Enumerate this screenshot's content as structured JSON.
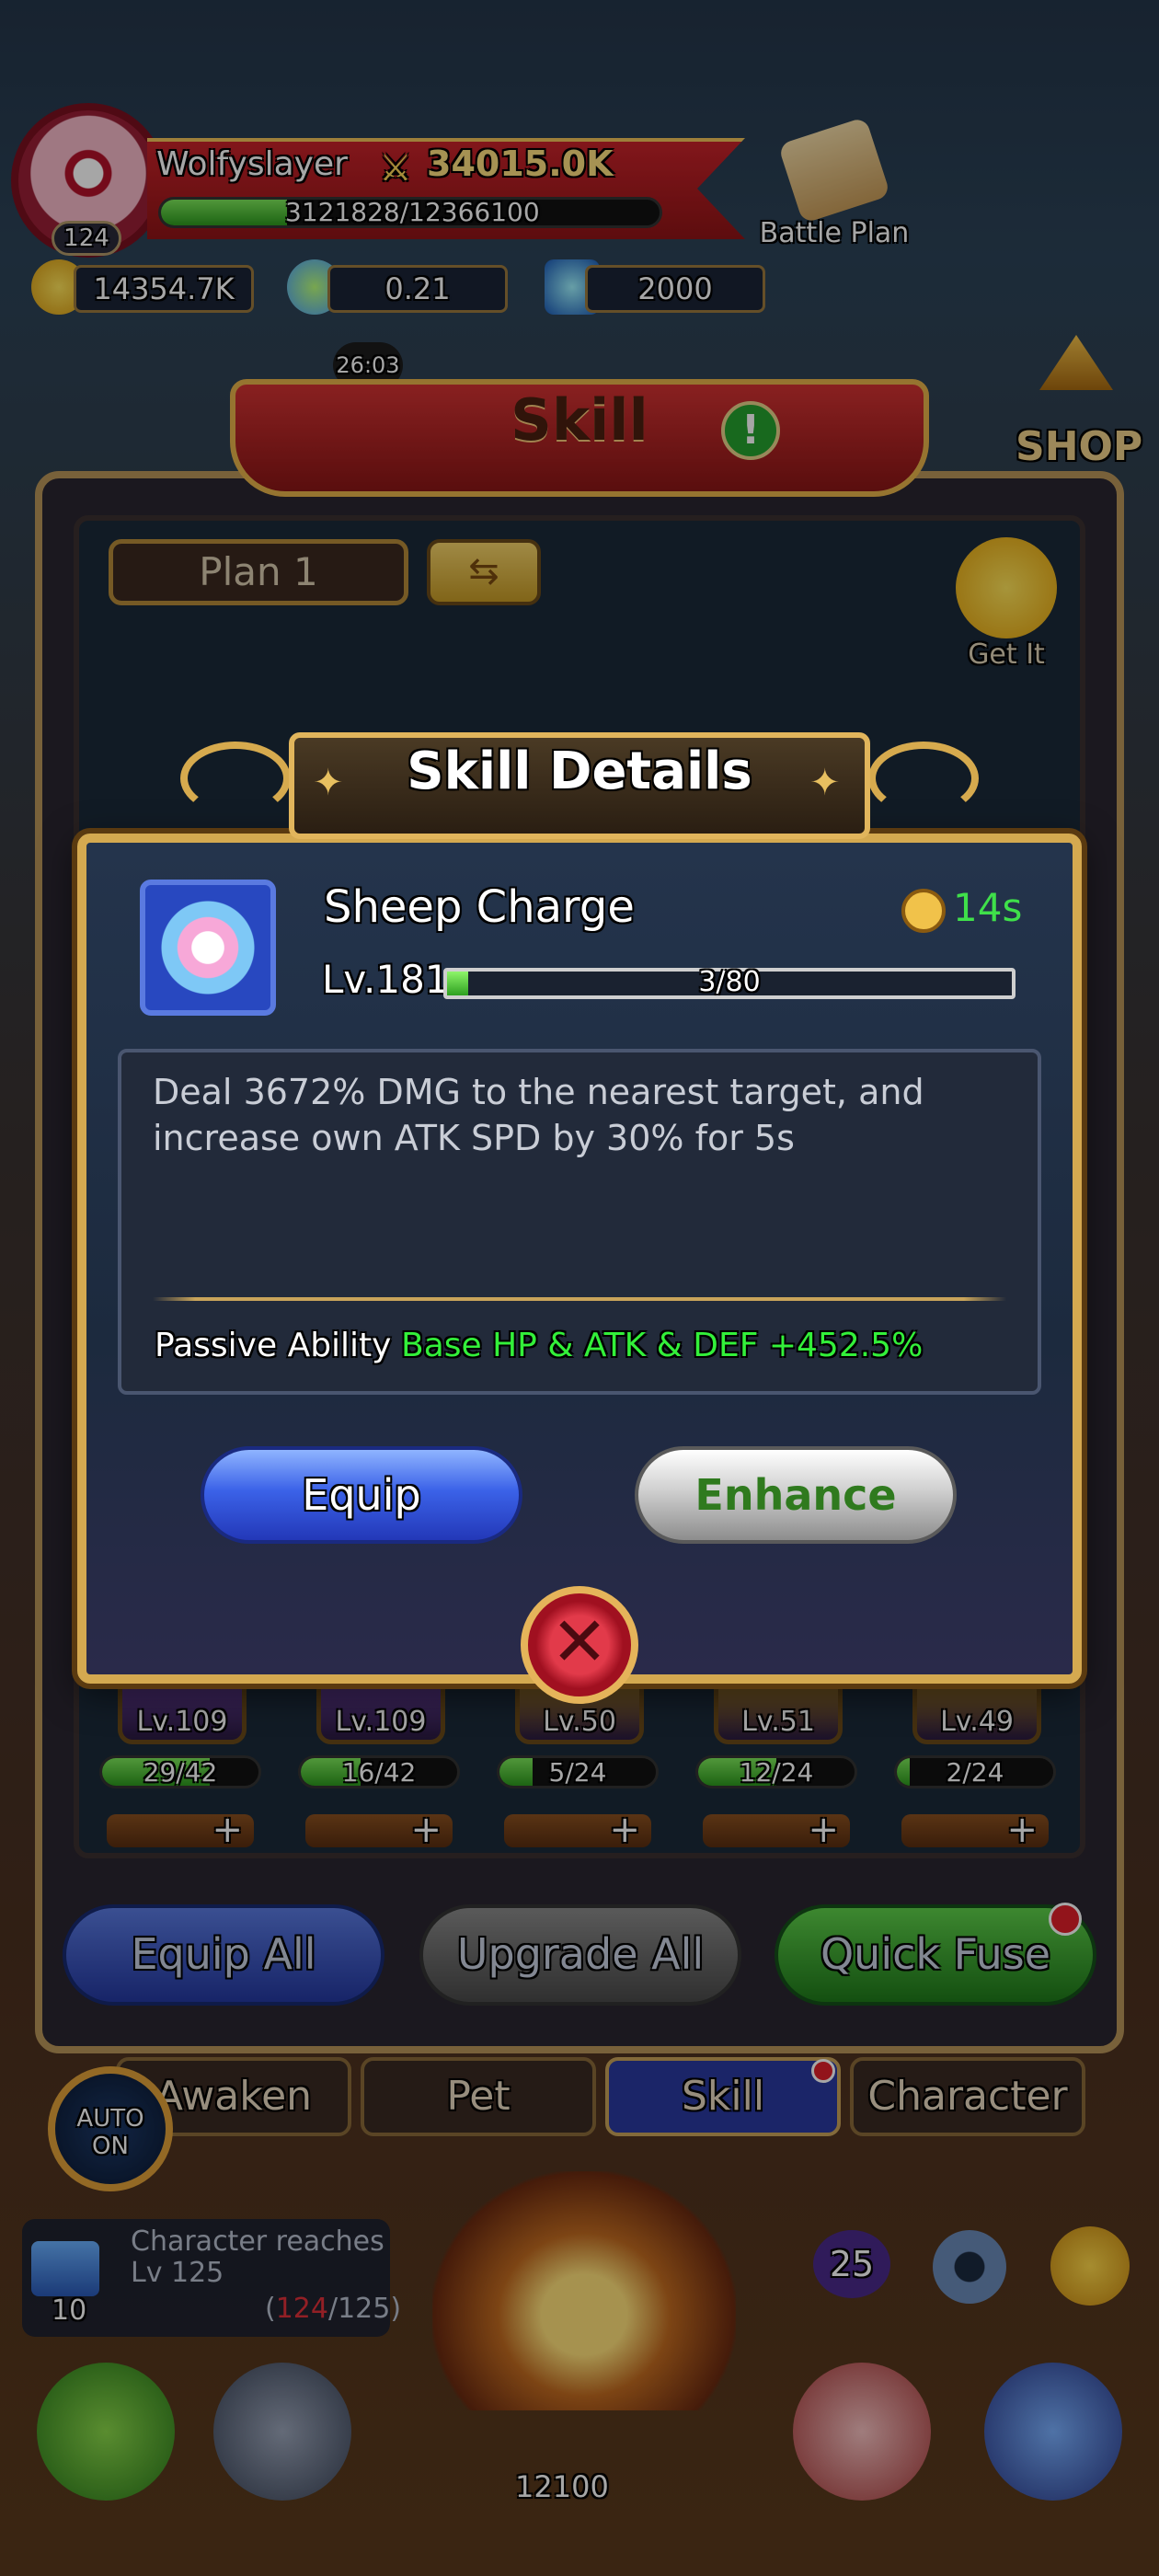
{
  "player": {
    "name": "Wolfyslayer",
    "level": "124",
    "power": "34015.0K",
    "xp_text": "3121828/12366100",
    "xp_fraction": 0.252
  },
  "resources": {
    "gold": "14354.7K",
    "stars": "0.21",
    "gems": "2000"
  },
  "header": {
    "battle_plan_label": "Battle Plan",
    "event_timer": "26:03",
    "shop_label": "SHOP"
  },
  "skill_screen": {
    "title": "Skill",
    "plan_label": "Plan 1",
    "swap_icon": "swap-arrows-icon",
    "get_it_label": "Get It",
    "slots": [
      {
        "level": "Lv.109",
        "progress": "29/42",
        "fraction": 0.69,
        "color": "#7a4ab8"
      },
      {
        "level": "Lv.109",
        "progress": "16/42",
        "fraction": 0.38,
        "color": "#7a4ab8"
      },
      {
        "level": "Lv.50",
        "progress": "5/24",
        "fraction": 0.21,
        "color": "#c99a1e"
      },
      {
        "level": "Lv.51",
        "progress": "12/24",
        "fraction": 0.5,
        "color": "#c99a1e"
      },
      {
        "level": "Lv.49",
        "progress": "2/24",
        "fraction": 0.08,
        "color": "#c99a1e"
      }
    ],
    "buttons": {
      "equip_all": "Equip All",
      "upgrade_all": "Upgrade All",
      "quick_fuse": "Quick Fuse"
    }
  },
  "tabs": [
    {
      "label": "Awaken"
    },
    {
      "label": "Pet"
    },
    {
      "label": "Skill"
    },
    {
      "label": "Character"
    }
  ],
  "bottom": {
    "auto_label": "AUTO ON",
    "quest_text": "Character reaches Lv 125",
    "quest_count": "10",
    "quest_current": "124",
    "quest_target": "/125)",
    "quest_open": "(",
    "badge_count": "25",
    "chest_count": "12100"
  },
  "modal": {
    "title": "Skill Details",
    "skill_name": "Sheep Charge",
    "cooldown": "14s",
    "level": "Lv.181",
    "level_progress": "3/80",
    "level_fraction": 0.0375,
    "description": "Deal 3672% DMG to the nearest target, and increase own ATK SPD by 30% for 5s",
    "passive_label": "Passive Ability :",
    "passive_value": "Base HP & ATK & DEF +452.5%",
    "equip_label": "Equip",
    "enhance_label": "Enhance",
    "close_icon": "close-x-icon"
  },
  "colors": {
    "accent_gold": "#d4a950",
    "cooldown_green": "#3fe04a",
    "passive_green": "#33f03a",
    "equip_blue": "#3b62e8"
  }
}
